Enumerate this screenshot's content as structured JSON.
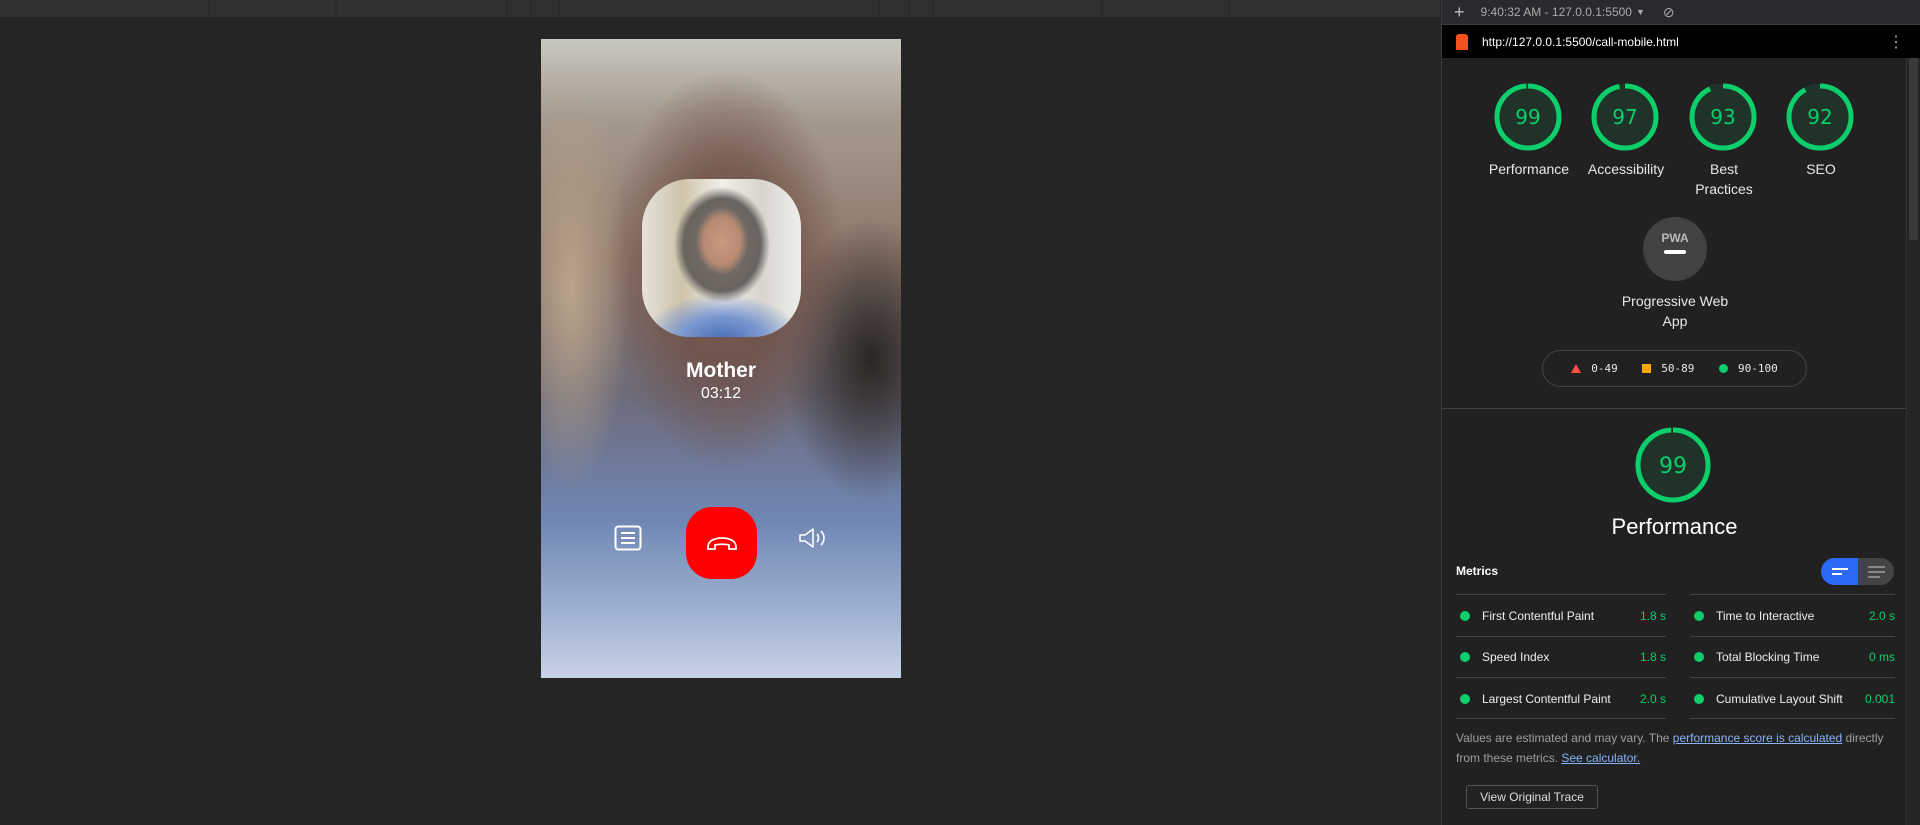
{
  "call": {
    "contact_name": "Mother",
    "duration": "03:12",
    "end_color": "#ff0000"
  },
  "devtools": {
    "toolbar": {
      "report_label": "9:40:32 AM - 127.0.0.1:5500"
    },
    "url": "http://127.0.0.1:5500/call-mobile.html",
    "scores": [
      {
        "label": "Performance",
        "value": 99
      },
      {
        "label": "Accessibility",
        "value": 97
      },
      {
        "label": "Best Practices",
        "value": 93
      },
      {
        "label": "SEO",
        "value": 92
      }
    ],
    "pwa": {
      "badge": "PWA",
      "label": "Progressive Web App"
    },
    "legend": [
      {
        "range": "0-49",
        "color": "#ff4e42"
      },
      {
        "range": "50-89",
        "color": "#ffa400"
      },
      {
        "range": "90-100",
        "color": "#0cce6b"
      }
    ],
    "performance": {
      "score": 99,
      "title": "Performance"
    },
    "metrics_title": "Metrics",
    "metrics": [
      {
        "label": "First Contentful Paint",
        "value": "1.8 s"
      },
      {
        "label": "Time to Interactive",
        "value": "2.0 s"
      },
      {
        "label": "Speed Index",
        "value": "1.8 s"
      },
      {
        "label": "Total Blocking Time",
        "value": "0 ms"
      },
      {
        "label": "Largest Contentful Paint",
        "value": "2.0 s"
      },
      {
        "label": "Cumulative Layout Shift",
        "value": "0.001"
      }
    ],
    "note": {
      "text1": "Values are estimated and may vary. The ",
      "link1": "performance score is calculated",
      "text2": " directly from these metrics. ",
      "link2": "See calculator."
    },
    "trace_button": "View Original Trace",
    "accent": "#0cce6b"
  }
}
